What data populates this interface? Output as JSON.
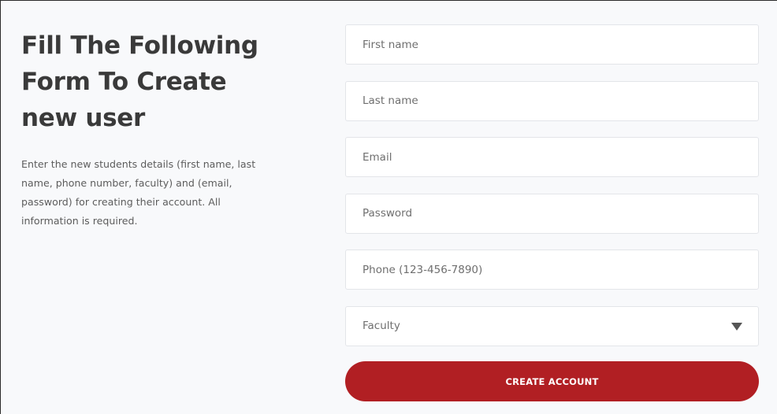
{
  "intro": {
    "title_line1": "Fill The Following",
    "title_line2": "Form To Create",
    "title_line3": "new user",
    "description": "Enter the new students details (first name, last name, phone number, faculty) and (email, password) for creating their account. All information is required."
  },
  "form": {
    "first_name_placeholder": "First name",
    "last_name_placeholder": "Last name",
    "email_placeholder": "Email",
    "password_placeholder": "Password",
    "phone_placeholder": "Phone (123-456-7890)",
    "faculty_select_label": "Faculty",
    "submit_label": "CREATE ACCOUNT"
  },
  "icons": {
    "dropdown": "caret-down"
  },
  "colors": {
    "accent": "#b11f23",
    "background": "#f8f9fb",
    "field_background": "#ffffff",
    "title_text": "#3a3a3a"
  }
}
